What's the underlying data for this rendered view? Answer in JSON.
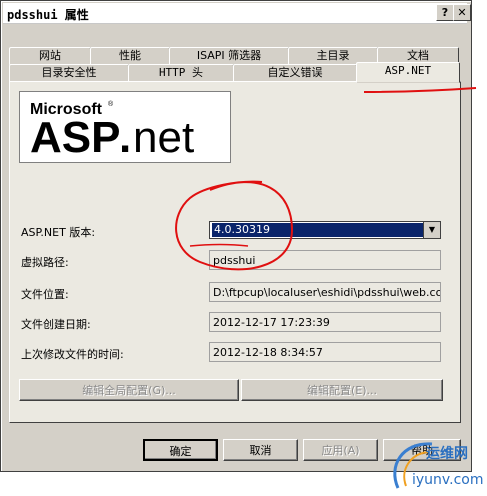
{
  "window": {
    "title": "pdsshui 属性",
    "help_glyph": "?",
    "close_glyph": "✕"
  },
  "tabs_back": [
    {
      "label": "网站"
    },
    {
      "label": "性能"
    },
    {
      "label": "ISAPI 筛选器"
    },
    {
      "label": "主目录"
    },
    {
      "label": "文档"
    }
  ],
  "tabs_front": [
    {
      "label": "目录安全性"
    },
    {
      "label": "HTTP 头"
    },
    {
      "label": "自定义错误"
    },
    {
      "label": "ASP.NET"
    }
  ],
  "logo": {
    "microsoft": "Microsoft",
    "reg": "®",
    "asp": "ASP",
    "dot": ".",
    "net": "net"
  },
  "form": {
    "version_label": "ASP.NET 版本:",
    "version_value": "4.0.30319",
    "vpath_label": "虚拟路径:",
    "vpath_value": "pdsshui",
    "location_label": "文件位置:",
    "location_value": "D:\\ftpcup\\localuser\\eshidi\\pdsshui\\web.config",
    "created_label": "文件创建日期:",
    "created_value": "2012-12-17 17:23:39",
    "modified_label": "上次修改文件的时间:",
    "modified_value": "2012-12-18 8:34:57"
  },
  "actions": {
    "edit_global": "编辑全局配置(G)...",
    "edit_config": "编辑配置(E)..."
  },
  "footer": {
    "ok": "确定",
    "cancel": "取消",
    "apply": "应用(A)",
    "help": "帮助"
  },
  "watermark": {
    "cn": "运维网",
    "url": "iyunv.com"
  },
  "colors": {
    "annotation_red": "#e01010",
    "selection_blue": "#0a246a",
    "dialog_face": "#d4d0c8"
  }
}
